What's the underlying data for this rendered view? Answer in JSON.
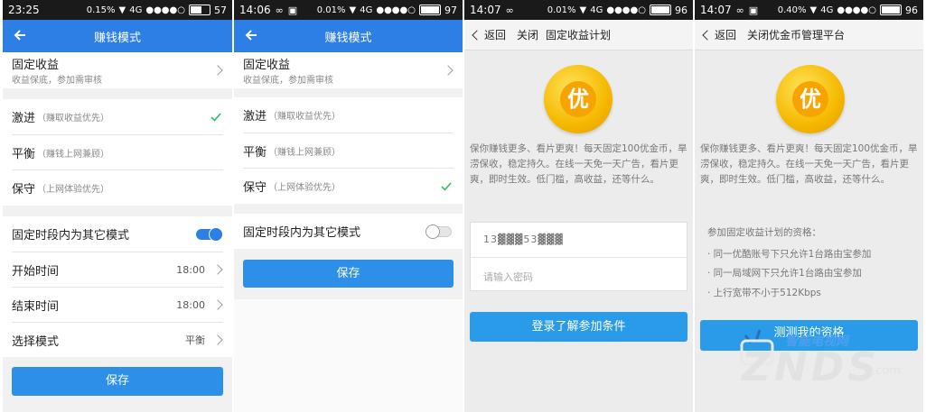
{
  "colors": {
    "accent": "#2d7fe5",
    "button": "#2a9be8",
    "check": "#2dbe60"
  },
  "panel1": {
    "status": {
      "time": "23:25",
      "speed": "0.15%",
      "net": "4G",
      "battery": "57"
    },
    "title": "赚钱模式",
    "fixed": {
      "title": "固定收益",
      "subtitle": "收益保底，参加需审核"
    },
    "modes": [
      {
        "title": "激进",
        "sub": "（赚取收益优先）"
      },
      {
        "title": "平衡",
        "sub": "（赚钱上网兼顾）"
      },
      {
        "title": "保守",
        "sub": "（上网体验优先）"
      }
    ],
    "toggle_label": "固定时段内为其它模式",
    "start": {
      "label": "开始时间",
      "value": "18:00"
    },
    "end": {
      "label": "结束时间",
      "value": "18:00"
    },
    "mode": {
      "label": "选择模式",
      "value": "平衡"
    },
    "save": "保存"
  },
  "panel2": {
    "status": {
      "time": "14:06",
      "speed": "0.01%",
      "net": "4G",
      "battery": "97"
    },
    "title": "赚钱模式",
    "fixed": {
      "title": "固定收益",
      "subtitle": "收益保底，参加需审核"
    },
    "modes": [
      {
        "title": "激进",
        "sub": "（赚取收益优先）"
      },
      {
        "title": "平衡",
        "sub": "（赚钱上网兼顾）"
      },
      {
        "title": "保守",
        "sub": "（上网体验优先）"
      }
    ],
    "toggle_label": "固定时段内为其它模式",
    "save": "保存"
  },
  "panel3": {
    "status": {
      "time": "14:07",
      "speed": "0.01%",
      "net": "4G",
      "battery": "96"
    },
    "back": "返回",
    "close": "关闭",
    "title": "固定收益计划",
    "coin": "优",
    "desc": "保你赚钱更多、看片更爽！每天固定100优金币，旱涝保收，稳定持久。在线一天免一天广告，看片更爽，即时生效。低门槛，高收益，还等什么。",
    "phone": "13▓▓▓53▓▓▓",
    "password_placeholder": "请输入密码",
    "login": "登录了解参加条件"
  },
  "panel4": {
    "status": {
      "time": "14:07",
      "speed": "0.40%",
      "net": "4G",
      "battery": "96"
    },
    "back": "返回",
    "close": "关闭",
    "title": "优金币管理平台",
    "coin": "优",
    "desc": "保你赚钱更多、看片更爽！每天固定100优金币，旱涝保收，稳定持久。在线一天免一天广告，看片更爽，即时生效。低门槛，高收益，还等什么。",
    "req_title": "参加固定收益计划的资格：",
    "reqs": [
      "· 同一优酷账号下只允许1台路由宝参加",
      "· 同一局域网下只允许1台路由宝参加",
      "· 上行宽带不小于512Kbps"
    ],
    "test": "测测我的资格",
    "watermark_cn": "智能电视网",
    "watermark_en": "ZNDS",
    "watermark_com": ".com"
  }
}
